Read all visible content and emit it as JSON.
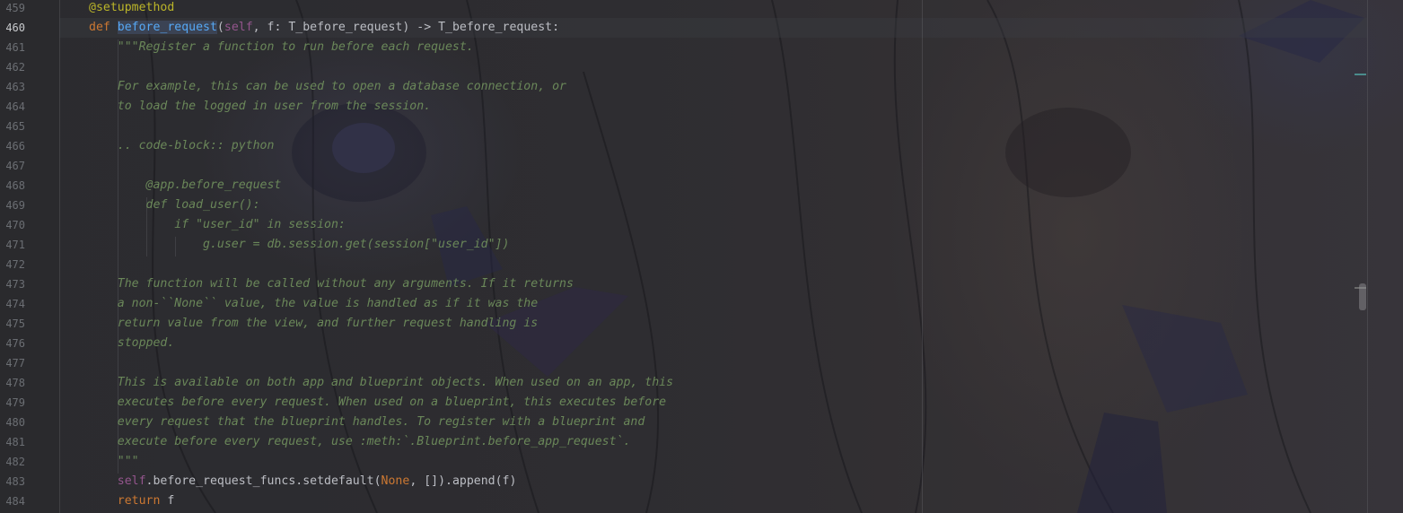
{
  "editor": {
    "language": "python",
    "current_line": 460,
    "lines": [
      {
        "num": "459",
        "segments": [
          {
            "cls": "deco",
            "text": "@setupmethod"
          }
        ]
      },
      {
        "num": "460",
        "segments": [
          {
            "cls": "kw",
            "text": "def "
          },
          {
            "cls": "fn-hl",
            "text": "before_request"
          },
          {
            "cls": "plain",
            "text": "("
          },
          {
            "cls": "self",
            "text": "self"
          },
          {
            "cls": "plain",
            "text": ", f: T_before_request) -> T_before_request:"
          }
        ]
      },
      {
        "num": "461",
        "segments": [
          {
            "cls": "doc",
            "text": "    \"\"\"Register a function to run before each request."
          }
        ]
      },
      {
        "num": "462",
        "segments": []
      },
      {
        "num": "463",
        "segments": [
          {
            "cls": "doc",
            "text": "    For example, this can be used to open a database connection, or"
          }
        ]
      },
      {
        "num": "464",
        "segments": [
          {
            "cls": "doc",
            "text": "    to load the logged in user from the session."
          }
        ]
      },
      {
        "num": "465",
        "segments": []
      },
      {
        "num": "466",
        "segments": [
          {
            "cls": "doc",
            "text": "    .. code-block:: python"
          }
        ]
      },
      {
        "num": "467",
        "segments": []
      },
      {
        "num": "468",
        "segments": [
          {
            "cls": "doc",
            "text": "        @app.before_request"
          }
        ]
      },
      {
        "num": "469",
        "segments": [
          {
            "cls": "doc",
            "text": "        def load_user():"
          }
        ]
      },
      {
        "num": "470",
        "segments": [
          {
            "cls": "doc",
            "text": "            if \"user_id\" in session:"
          }
        ]
      },
      {
        "num": "471",
        "segments": [
          {
            "cls": "doc",
            "text": "                g.user = db.session.get(session[\"user_id\"])"
          }
        ]
      },
      {
        "num": "472",
        "segments": []
      },
      {
        "num": "473",
        "segments": [
          {
            "cls": "doc",
            "text": "    The function will be called without any arguments. If it returns"
          }
        ]
      },
      {
        "num": "474",
        "segments": [
          {
            "cls": "doc",
            "text": "    a non-``None`` value, the value is handled as if it was the"
          }
        ]
      },
      {
        "num": "475",
        "segments": [
          {
            "cls": "doc",
            "text": "    return value from the view, and further request handling is"
          }
        ]
      },
      {
        "num": "476",
        "segments": [
          {
            "cls": "doc",
            "text": "    stopped."
          }
        ]
      },
      {
        "num": "477",
        "segments": []
      },
      {
        "num": "478",
        "segments": [
          {
            "cls": "doc",
            "text": "    This is available on both app and blueprint objects. When used on an app, this"
          }
        ]
      },
      {
        "num": "479",
        "segments": [
          {
            "cls": "doc",
            "text": "    executes before every request. When used on a blueprint, this executes before"
          }
        ]
      },
      {
        "num": "480",
        "segments": [
          {
            "cls": "doc",
            "text": "    every request that the blueprint handles. To register with a blueprint and"
          }
        ]
      },
      {
        "num": "481",
        "segments": [
          {
            "cls": "doc",
            "text": "    execute before every request, use :meth:`.Blueprint.before_app_request`."
          }
        ]
      },
      {
        "num": "482",
        "segments": [
          {
            "cls": "doc",
            "text": "    \"\"\""
          }
        ]
      },
      {
        "num": "483",
        "segments": [
          {
            "cls": "self",
            "text": "    self"
          },
          {
            "cls": "plain",
            "text": ".before_request_funcs.setdefault("
          },
          {
            "cls": "none",
            "text": "None"
          },
          {
            "cls": "plain",
            "text": ", []).append(f)"
          }
        ]
      },
      {
        "num": "484",
        "segments": [
          {
            "cls": "kw",
            "text": "    return "
          },
          {
            "cls": "plain",
            "text": "f"
          }
        ]
      }
    ]
  }
}
